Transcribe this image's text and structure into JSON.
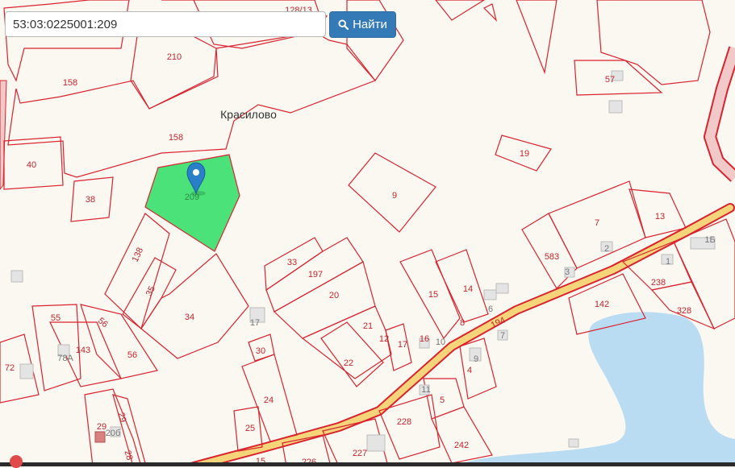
{
  "search": {
    "value": "53:03:0225001:209"
  },
  "find_button": {
    "label": "Найти",
    "icon": "search-icon"
  },
  "locality": "Красилово",
  "selected_parcel": "209",
  "colors": {
    "background": "#fbf8f1",
    "parcel_border": "#d9232f",
    "selected_fill": "#4be27a",
    "water": "#b9dcf3",
    "road": "#f6d57a",
    "button": "#337ab7",
    "marker": "#2a80c8"
  },
  "parcel_labels": [
    "128/13",
    "210",
    "158",
    "158",
    "40",
    "38",
    "209",
    "57",
    "19",
    "9",
    "7",
    "13",
    "1Б",
    "583",
    "2",
    "3",
    "1",
    "238",
    "328",
    "142",
    "33",
    "197",
    "20",
    "138",
    "35",
    "34",
    "17",
    "21",
    "22",
    "30",
    "24",
    "25",
    "12",
    "17",
    "16",
    "10",
    "15",
    "14",
    "8",
    "6",
    "194",
    "7",
    "9",
    "4",
    "11",
    "5",
    "228",
    "227",
    "242",
    "226",
    "55",
    "56",
    "143",
    "78А",
    "56",
    "72",
    "29",
    "29",
    "20б",
    "28",
    "15"
  ]
}
